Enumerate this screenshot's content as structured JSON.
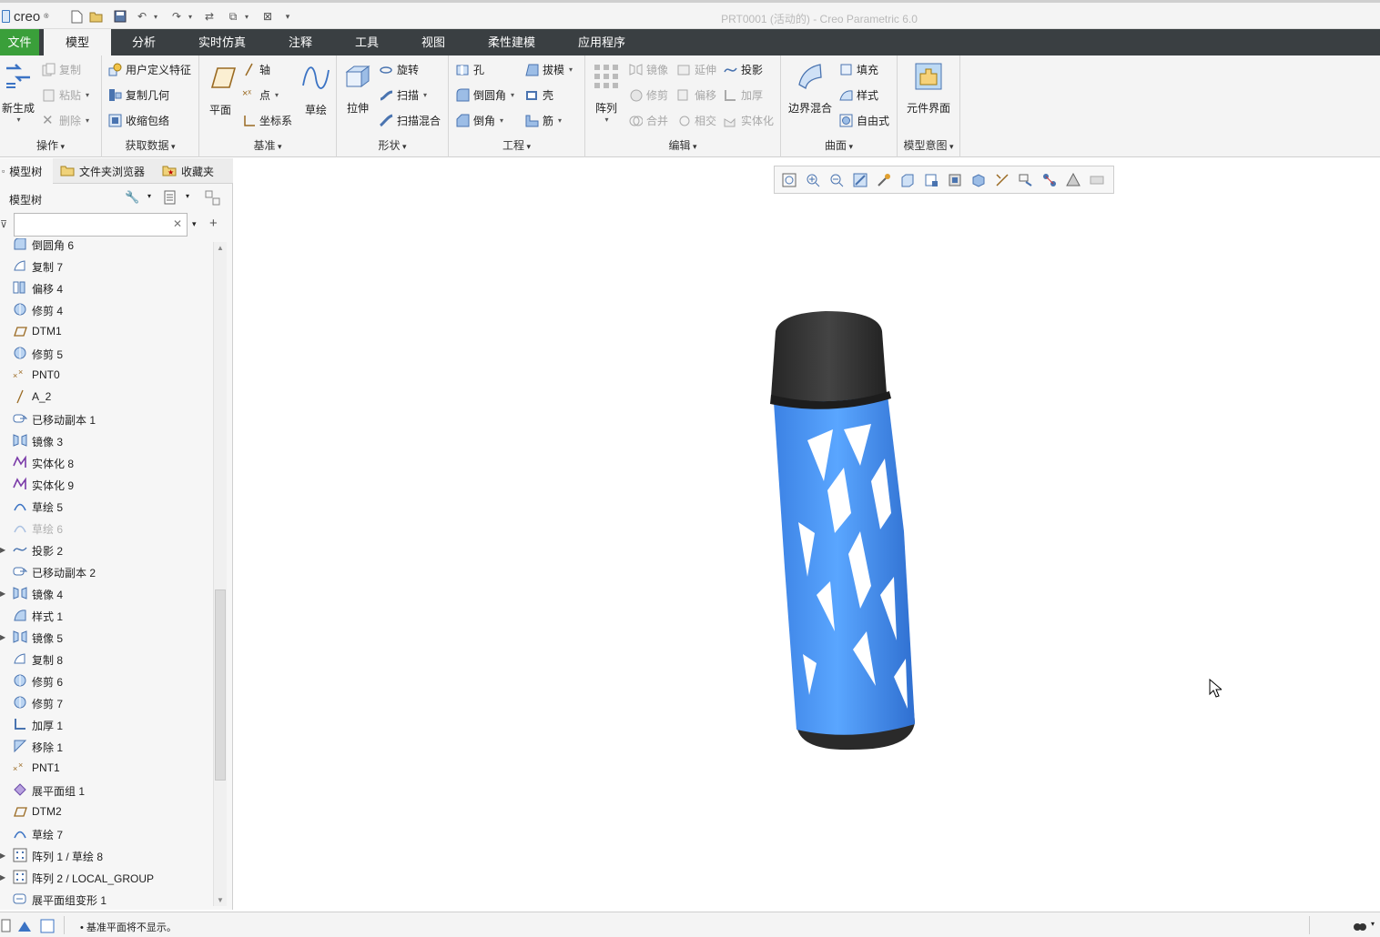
{
  "app": {
    "logo_text": "creo"
  },
  "window_title": "PRT0001 (活动的) - Creo Parametric 6.0",
  "menu": {
    "file": "文件",
    "tabs": [
      "模型",
      "分析",
      "实时仿真",
      "注释",
      "工具",
      "视图",
      "柔性建模",
      "应用程序"
    ],
    "active_tab": "模型"
  },
  "ribbon": {
    "operations": {
      "regenerate": "新生成",
      "copy": "复制",
      "paste": "粘贴",
      "delete": "删除",
      "label": "操作"
    },
    "get_data": {
      "udf": "用户定义特征",
      "copy_geom": "复制几何",
      "shrinkwrap": "收缩包络",
      "label": "获取数据"
    },
    "datum": {
      "plane": "平面",
      "axis": "轴",
      "point": "点",
      "csys": "坐标系",
      "sketch": "草绘",
      "label": "基准"
    },
    "shapes": {
      "extrude": "拉伸",
      "revolve": "旋转",
      "sweep": "扫描",
      "swept_blend": "扫描混合",
      "label": "形状"
    },
    "engineering": {
      "hole": "孔",
      "round": "倒圆角",
      "chamfer": "倒角",
      "draft": "拔模",
      "shell": "壳",
      "rib": "筋",
      "label": "工程"
    },
    "editing": {
      "pattern": "阵列",
      "mirror": "镜像",
      "extend": "延伸",
      "project": "投影",
      "trim": "修剪",
      "offset": "偏移",
      "thicken": "加厚",
      "merge": "合并",
      "intersect": "相交",
      "solidify": "实体化",
      "label": "编辑"
    },
    "surfaces": {
      "boundary_blend": "边界混合",
      "fill": "填充",
      "style": "样式",
      "freestyle": "自由式",
      "label": "曲面"
    },
    "model_intent": {
      "component_interface": "元件界面",
      "label": "模型意图"
    }
  },
  "left_panel": {
    "tabs": [
      "模型树",
      "文件夹浏览器",
      "收藏夹"
    ],
    "tree_title": "模型树",
    "search_value": "",
    "items": [
      {
        "label": "倒圆角 6",
        "icon": "round-icon",
        "expandable": false,
        "dim": false
      },
      {
        "label": "复制 7",
        "icon": "copy-icon",
        "expandable": false,
        "dim": false
      },
      {
        "label": "偏移 4",
        "icon": "offset-icon",
        "expandable": false,
        "dim": false
      },
      {
        "label": "修剪 4",
        "icon": "trim-icon",
        "expandable": false,
        "dim": false
      },
      {
        "label": "DTM1",
        "icon": "datum-plane-icon",
        "expandable": false,
        "dim": false
      },
      {
        "label": "修剪 5",
        "icon": "trim-icon",
        "expandable": false,
        "dim": false
      },
      {
        "label": "PNT0",
        "icon": "datum-point-icon",
        "expandable": false,
        "dim": false
      },
      {
        "label": "A_2",
        "icon": "datum-axis-icon",
        "expandable": false,
        "dim": false
      },
      {
        "label": "已移动副本 1",
        "icon": "moved-copy-icon",
        "expandable": false,
        "dim": false
      },
      {
        "label": "镜像 3",
        "icon": "mirror-icon",
        "expandable": false,
        "dim": false
      },
      {
        "label": "实体化 8",
        "icon": "solidify-icon",
        "expandable": false,
        "dim": false
      },
      {
        "label": "实体化 9",
        "icon": "solidify-icon",
        "expandable": false,
        "dim": false
      },
      {
        "label": "草绘 5",
        "icon": "sketch-icon",
        "expandable": false,
        "dim": false
      },
      {
        "label": "草绘 6",
        "icon": "sketch-icon",
        "expandable": false,
        "dim": true
      },
      {
        "label": "投影 2",
        "icon": "project-icon",
        "expandable": true,
        "dim": false
      },
      {
        "label": "已移动副本 2",
        "icon": "moved-copy-icon",
        "expandable": false,
        "dim": false
      },
      {
        "label": "镜像 4",
        "icon": "mirror-icon",
        "expandable": true,
        "dim": false
      },
      {
        "label": "样式 1",
        "icon": "style-icon",
        "expandable": false,
        "dim": false
      },
      {
        "label": "镜像 5",
        "icon": "mirror-icon",
        "expandable": true,
        "dim": false
      },
      {
        "label": "复制 8",
        "icon": "copy-icon",
        "expandable": false,
        "dim": false
      },
      {
        "label": "修剪 6",
        "icon": "trim-icon",
        "expandable": false,
        "dim": false
      },
      {
        "label": "修剪 7",
        "icon": "trim-icon",
        "expandable": false,
        "dim": false
      },
      {
        "label": "加厚 1",
        "icon": "thicken-icon",
        "expandable": false,
        "dim": false
      },
      {
        "label": "移除 1",
        "icon": "remove-icon",
        "expandable": false,
        "dim": false
      },
      {
        "label": "PNT1",
        "icon": "datum-point-icon",
        "expandable": false,
        "dim": false
      },
      {
        "label": "展平面组 1",
        "icon": "flatten-quilt-icon",
        "expandable": false,
        "dim": false
      },
      {
        "label": "DTM2",
        "icon": "datum-plane-icon",
        "expandable": false,
        "dim": false
      },
      {
        "label": "草绘 7",
        "icon": "sketch-icon",
        "expandable": false,
        "dim": false
      },
      {
        "label": "阵列 1 / 草绘 8",
        "icon": "pattern-icon",
        "expandable": true,
        "dim": false
      },
      {
        "label": "阵列 2 / LOCAL_GROUP",
        "icon": "pattern-icon",
        "expandable": true,
        "dim": false
      },
      {
        "label": "展平面组变形 1",
        "icon": "flatten-deform-icon",
        "expandable": false,
        "dim": false
      }
    ]
  },
  "status": {
    "message": "• 基准平面将不显示。"
  },
  "colors": {
    "menubar": "#3a3f42",
    "file_tab": "#3a9f3a",
    "model_blue": "#3f8ff0",
    "cap_dark": "#2f2f2f"
  }
}
